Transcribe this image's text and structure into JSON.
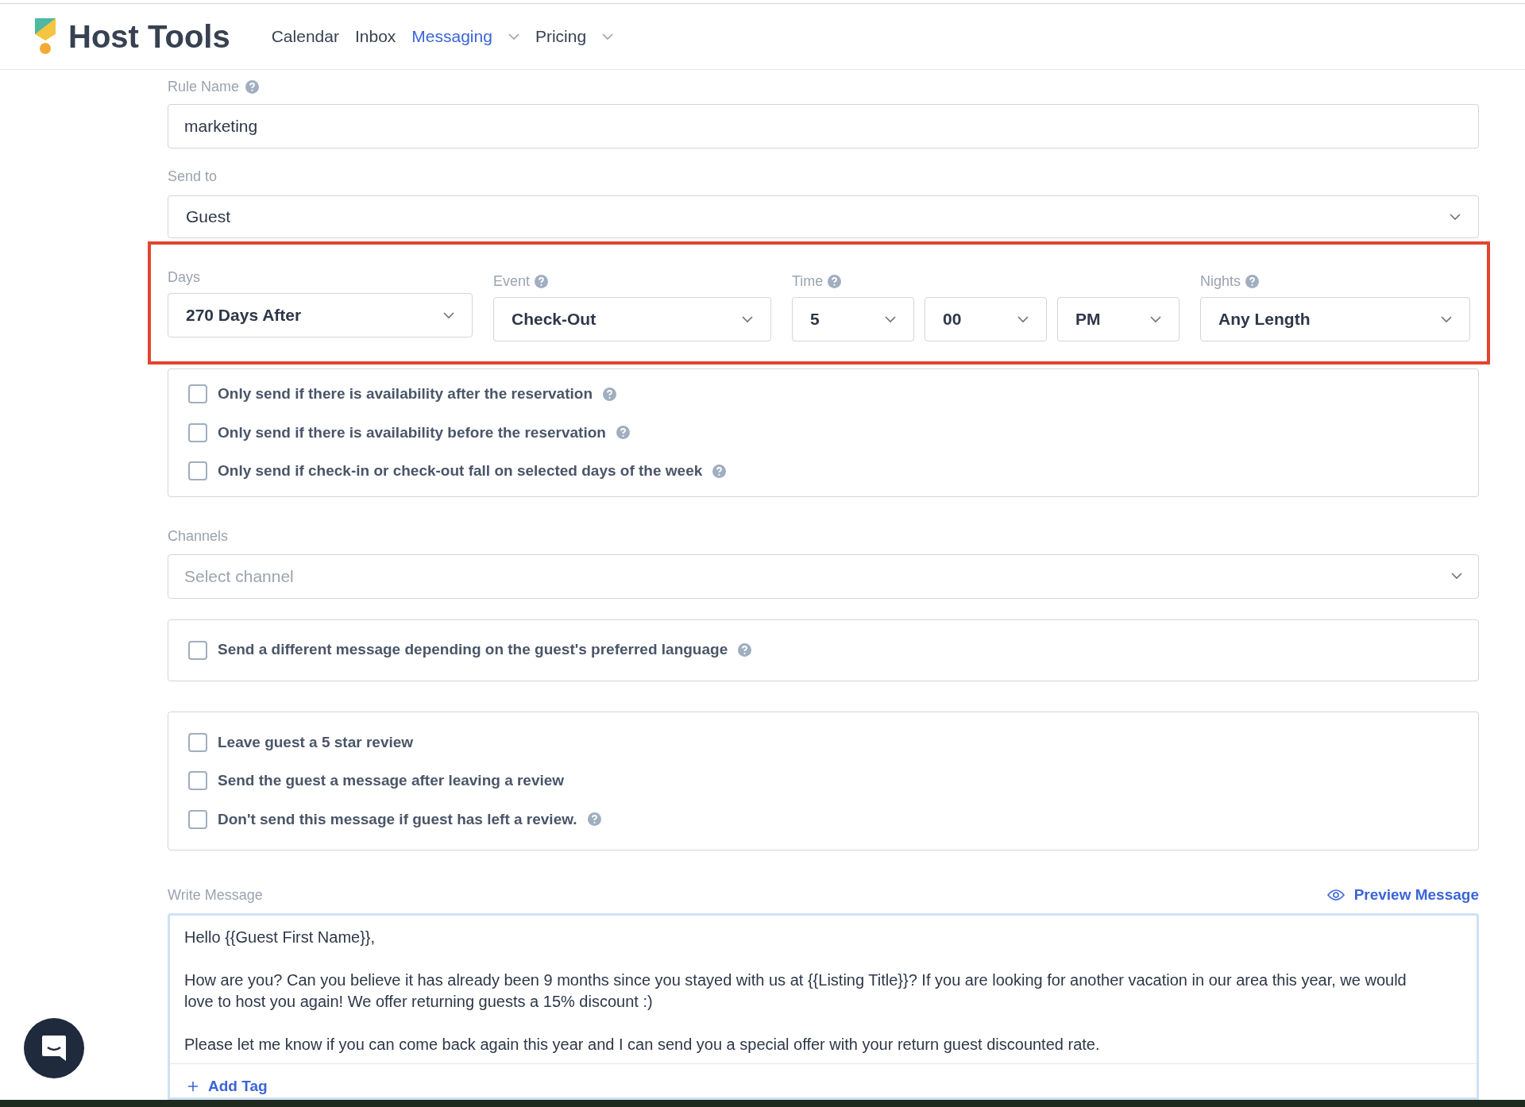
{
  "header": {
    "brand": "Host Tools",
    "nav": [
      {
        "label": "Calendar",
        "selected": false,
        "dropdown": false
      },
      {
        "label": "Inbox",
        "selected": false,
        "dropdown": false
      },
      {
        "label": "Messaging",
        "selected": true,
        "dropdown": true
      },
      {
        "label": "Pricing",
        "selected": false,
        "dropdown": true
      }
    ]
  },
  "rule_name": {
    "label": "Rule Name",
    "value": "marketing"
  },
  "send_to": {
    "label": "Send to",
    "value": "Guest"
  },
  "schedule": {
    "days": {
      "label": "Days",
      "value": "270 Days After"
    },
    "event": {
      "label": "Event",
      "value": "Check-Out"
    },
    "time": {
      "label": "Time",
      "hour": "5",
      "minute": "00",
      "period": "PM"
    },
    "nights": {
      "label": "Nights",
      "value": "Any Length"
    }
  },
  "availability_options": [
    {
      "label": "Only send if there is availability after the reservation",
      "checked": false
    },
    {
      "label": "Only send if there is availability before the reservation",
      "checked": false
    },
    {
      "label": "Only send if check-in or check-out fall on selected days of the week",
      "checked": false
    }
  ],
  "channels": {
    "label": "Channels",
    "placeholder": "Select channel"
  },
  "language_options": [
    {
      "label": "Send a different message depending on the guest's preferred language",
      "checked": false,
      "help": true
    }
  ],
  "review_options": [
    {
      "label": "Leave guest a 5 star review",
      "checked": false,
      "help": false
    },
    {
      "label": "Send the guest a message after leaving a review",
      "checked": false,
      "help": false
    },
    {
      "label": "Don't send this message if guest has left a review.",
      "checked": false,
      "help": true
    }
  ],
  "message": {
    "label": "Write Message",
    "preview": "Preview Message",
    "paragraphs": [
      "Hello {{Guest First Name}},",
      "How are you? Can you believe it has already been 9 months since you stayed with us at {{Listing Title}}? If you are looking for another vacation in our area this year, we would love to host you again! We offer returning guests a 15% discount :)",
      "Please let me know if you can come back again this year and I can send you a special offer with your return guest discounted rate."
    ],
    "add_tag": "Add Tag"
  }
}
